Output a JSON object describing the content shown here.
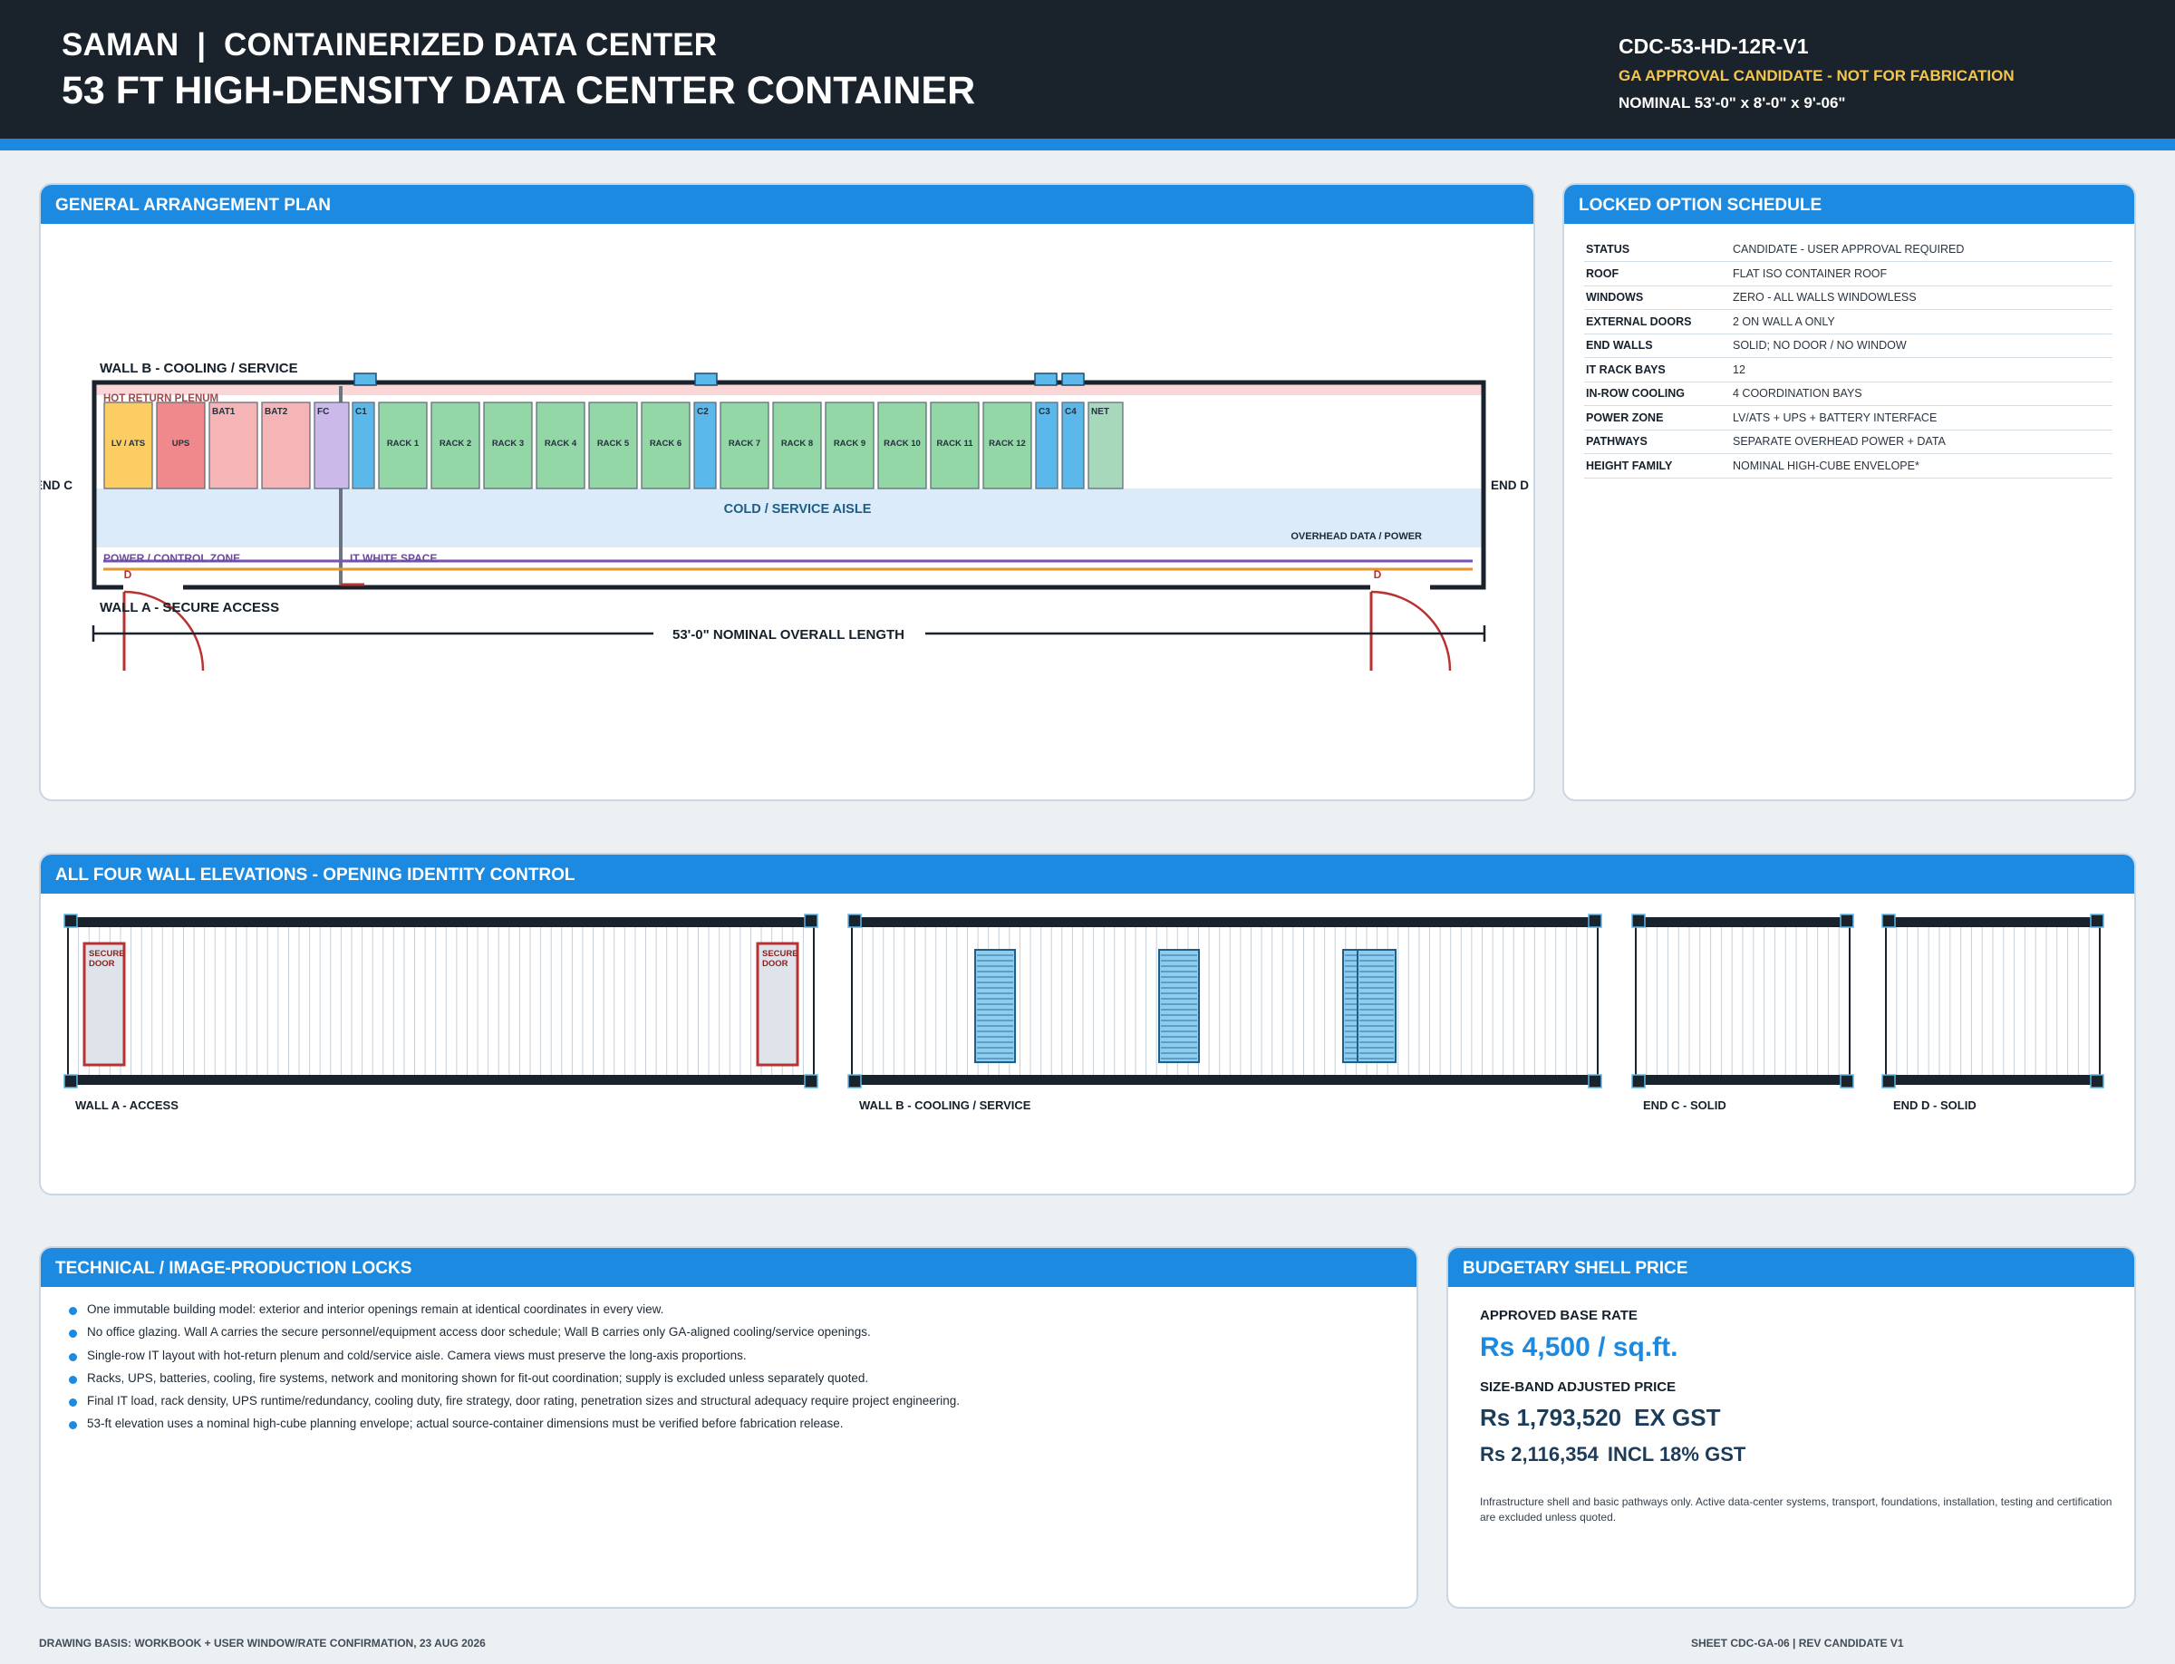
{
  "header": {
    "brand": "SAMAN",
    "separator": "|",
    "subtitle": "CONTAINERIZED DATA CENTER",
    "title": "53 FT HIGH-DENSITY DATA CENTER CONTAINER",
    "doc_code": "CDC-53-HD-12R-V1",
    "status": "GA APPROVAL CANDIDATE - NOT FOR FABRICATION",
    "dimensions": "NOMINAL 53'-0\" x 8'-0\" x 9'-06\""
  },
  "colors": {
    "header_bg": "#1a222c",
    "accent": "#1b8ae0",
    "status_yellow": "#f2c64f",
    "lv_ats": "#fbcd62",
    "ups": "#f0898c",
    "battery": "#f5b5b7",
    "fire_control": "#cbb9ea",
    "cooler": "#5bb8ea",
    "rack": "#92d7a5",
    "net": "#a8d8bb",
    "door": "#b83232"
  },
  "ga_plan": {
    "heading": "GENERAL ARRANGEMENT PLAN",
    "wall_b_label": "WALL B - COOLING / SERVICE",
    "wall_a_label": "WALL A - SECURE ACCESS",
    "end_c_label": "END C",
    "end_d_label": "END D",
    "hot_plenum_label": "HOT RETURN PLENUM",
    "aisle_label": "COLD / SERVICE AISLE",
    "overhead_label": "OVERHEAD DATA / POWER",
    "power_zone_label": "POWER / CONTROL ZONE",
    "white_space_label": "IT WHITE SPACE",
    "door_tag": "D",
    "length_label": "53'-0\" NOMINAL OVERALL LENGTH",
    "equipment": [
      {
        "label": "LV / ATS",
        "kind": "lv_ats"
      },
      {
        "label": "UPS",
        "kind": "ups"
      },
      {
        "label": "BAT1",
        "kind": "battery"
      },
      {
        "label": "BAT2",
        "kind": "battery"
      },
      {
        "label": "FC",
        "kind": "fire_control"
      },
      {
        "label": "C1",
        "kind": "cooler"
      },
      {
        "label": "RACK 1",
        "kind": "rack"
      },
      {
        "label": "RACK 2",
        "kind": "rack"
      },
      {
        "label": "RACK 3",
        "kind": "rack"
      },
      {
        "label": "RACK 4",
        "kind": "rack"
      },
      {
        "label": "RACK 5",
        "kind": "rack"
      },
      {
        "label": "RACK 6",
        "kind": "rack"
      },
      {
        "label": "C2",
        "kind": "cooler"
      },
      {
        "label": "RACK 7",
        "kind": "rack"
      },
      {
        "label": "RACK 8",
        "kind": "rack"
      },
      {
        "label": "RACK 9",
        "kind": "rack"
      },
      {
        "label": "RACK 10",
        "kind": "rack"
      },
      {
        "label": "RACK 11",
        "kind": "rack"
      },
      {
        "label": "RACK 12",
        "kind": "rack"
      },
      {
        "label": "C3",
        "kind": "cooler"
      },
      {
        "label": "C4",
        "kind": "cooler"
      },
      {
        "label": "NET",
        "kind": "net"
      }
    ]
  },
  "options": {
    "heading": "LOCKED OPTION SCHEDULE",
    "rows": [
      {
        "key": "STATUS",
        "value": "CANDIDATE - USER APPROVAL REQUIRED"
      },
      {
        "key": "ROOF",
        "value": "FLAT ISO CONTAINER ROOF"
      },
      {
        "key": "WINDOWS",
        "value": "ZERO - ALL WALLS WINDOWLESS"
      },
      {
        "key": "EXTERNAL DOORS",
        "value": "2 ON WALL A ONLY"
      },
      {
        "key": "END WALLS",
        "value": "SOLID; NO DOOR / NO WINDOW"
      },
      {
        "key": "IT RACK BAYS",
        "value": "12"
      },
      {
        "key": "IN-ROW COOLING",
        "value": "4 COORDINATION BAYS"
      },
      {
        "key": "POWER ZONE",
        "value": "LV/ATS + UPS + BATTERY INTERFACE"
      },
      {
        "key": "PATHWAYS",
        "value": "SEPARATE OVERHEAD POWER + DATA"
      },
      {
        "key": "HEIGHT FAMILY",
        "value": "NOMINAL HIGH-CUBE ENVELOPE*"
      }
    ]
  },
  "elevations": {
    "heading": "ALL FOUR WALL ELEVATIONS - OPENING IDENTITY CONTROL",
    "secure_door_label_1": "SECURE",
    "secure_door_label_2": "DOOR",
    "walls": [
      {
        "label": "WALL A - ACCESS"
      },
      {
        "label": "WALL B - COOLING / SERVICE"
      },
      {
        "label": "END C - SOLID"
      },
      {
        "label": "END D - SOLID"
      }
    ]
  },
  "tech": {
    "heading": "TECHNICAL / IMAGE-PRODUCTION LOCKS",
    "items": [
      "One immutable building model: exterior and interior openings remain at identical coordinates in every view.",
      "No office glazing. Wall A carries the secure personnel/equipment access door schedule; Wall B carries only GA-aligned cooling/service openings.",
      "Single-row IT layout with hot-return plenum and cold/service aisle. Camera views must preserve the long-axis proportions.",
      "Racks, UPS, batteries, cooling, fire systems, network and monitoring shown for fit-out coordination; supply is excluded unless separately quoted.",
      "Final IT load, rack density, UPS runtime/redundancy, cooling duty, fire strategy, door rating, penetration sizes and structural adequacy require project engineering.",
      "53-ft elevation uses a nominal high-cube planning envelope; actual source-container dimensions must be verified before fabrication release."
    ]
  },
  "price": {
    "heading": "BUDGETARY SHELL PRICE",
    "base_label": "APPROVED BASE RATE",
    "base_rate": "Rs 4,500 / sq.ft.",
    "adjusted_label": "SIZE-BAND ADJUSTED PRICE",
    "ex_amount": "Rs 1,793,520",
    "ex_suffix": "EX GST",
    "incl_amount": "Rs 2,116,354",
    "incl_suffix": "INCL 18% GST",
    "note": "Infrastructure shell and basic pathways only. Active data-center systems, transport, foundations, installation, testing and certification are excluded unless quoted."
  },
  "footer": {
    "basis": "DRAWING BASIS: WORKBOOK + USER WINDOW/RATE CONFIRMATION, 23 AUG 2026",
    "sheet": "SHEET CDC-GA-06  |  REV CANDIDATE V1"
  }
}
